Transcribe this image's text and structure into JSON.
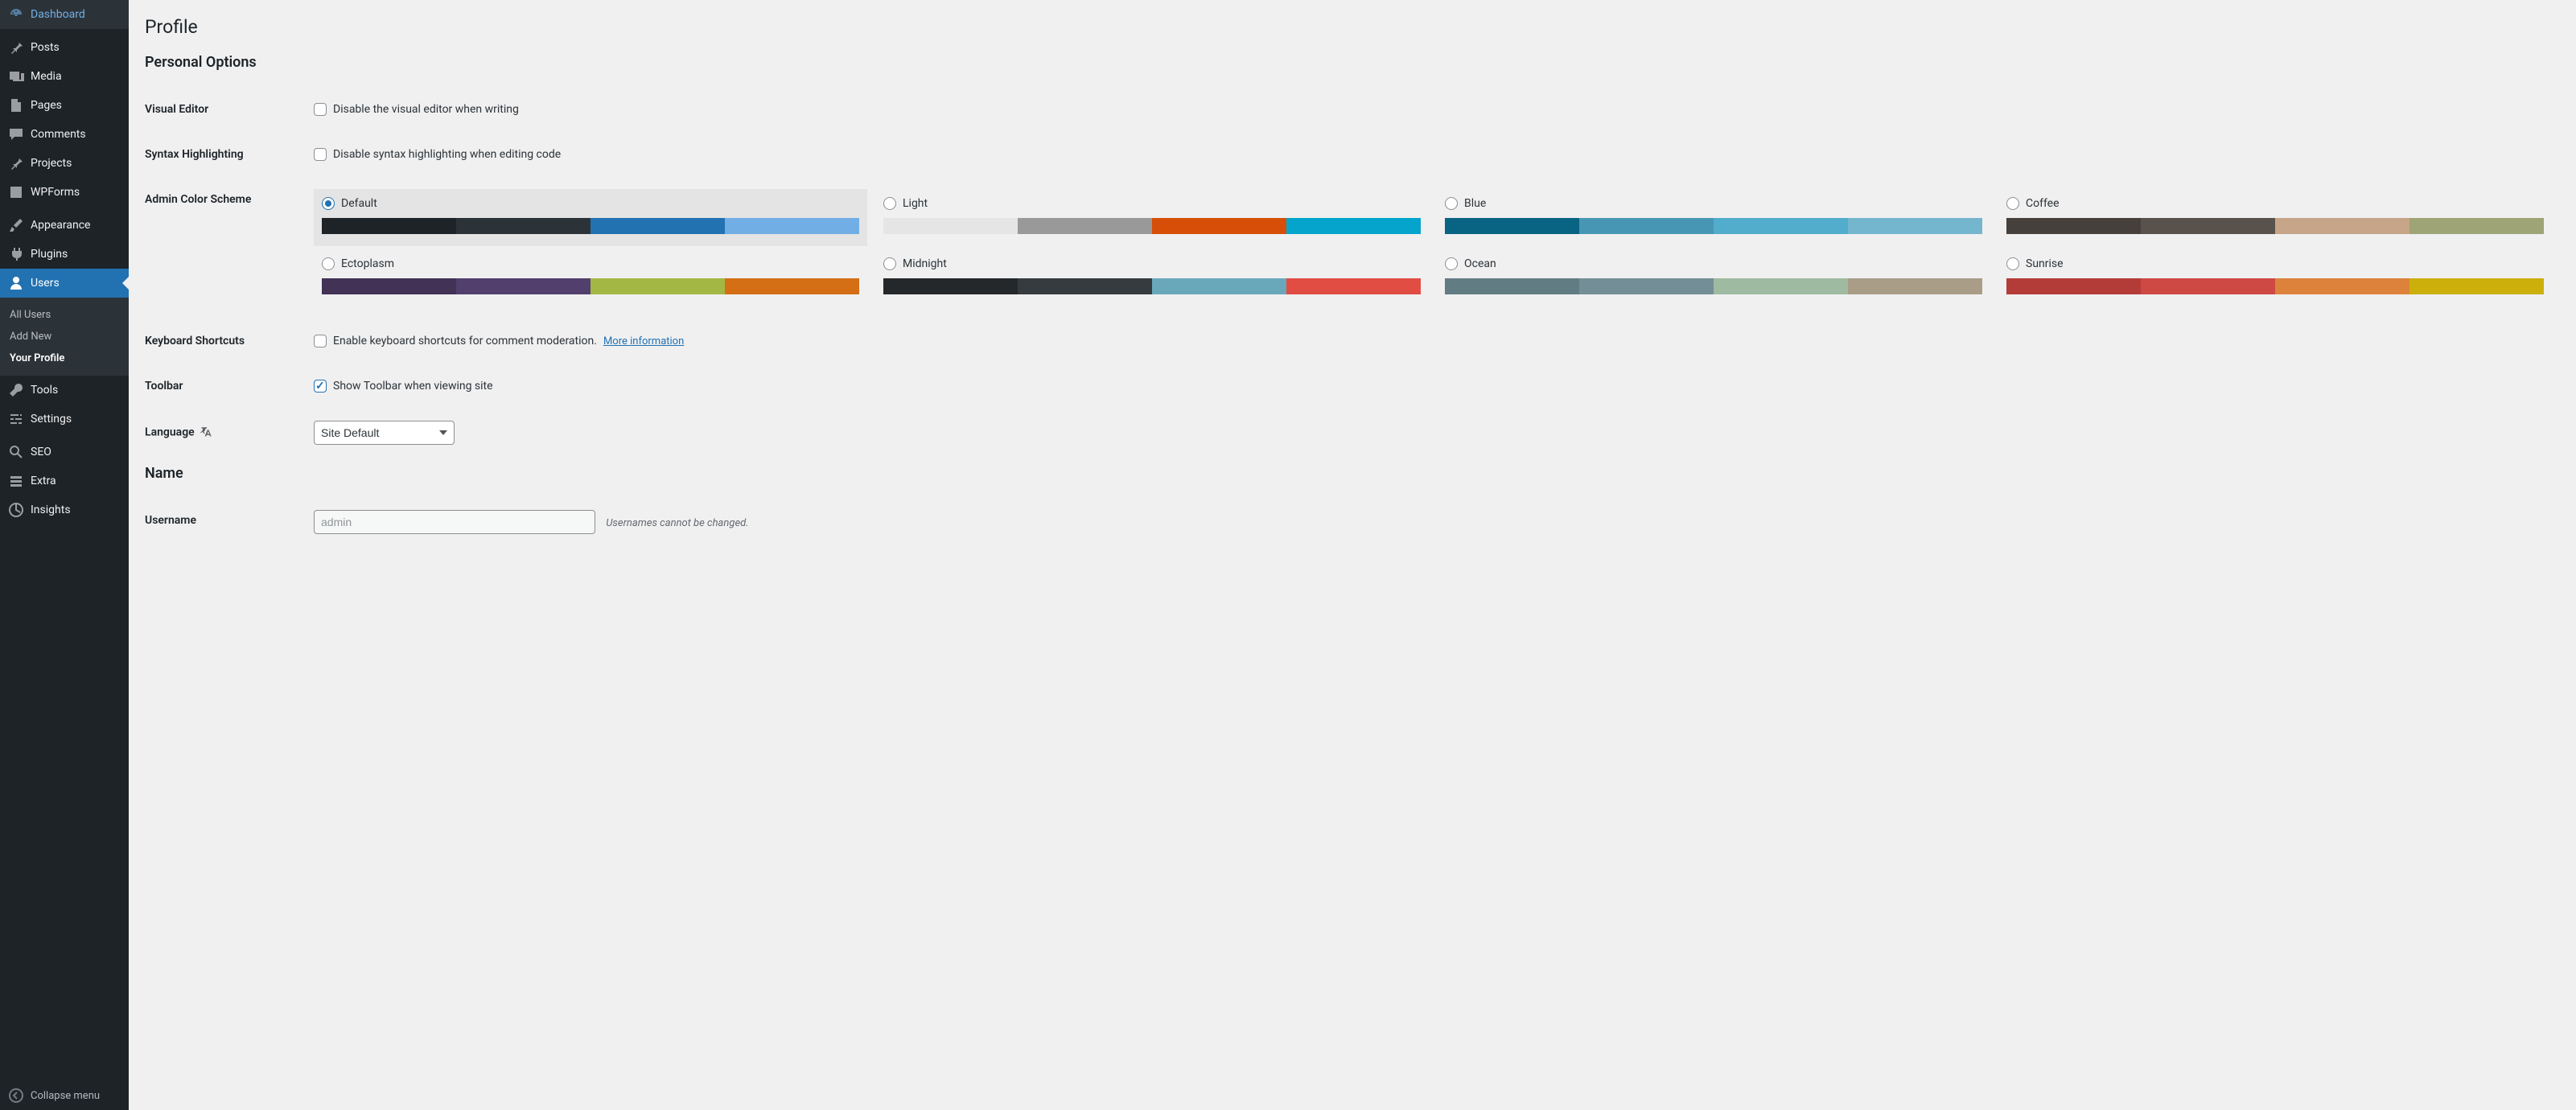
{
  "sidebar": {
    "dashboard": "Dashboard",
    "posts": "Posts",
    "media": "Media",
    "pages": "Pages",
    "comments": "Comments",
    "projects": "Projects",
    "wpforms": "WPForms",
    "appearance": "Appearance",
    "plugins": "Plugins",
    "users": "Users",
    "tools": "Tools",
    "settings": "Settings",
    "seo": "SEO",
    "extra": "Extra",
    "insights": "Insights",
    "collapse": "Collapse menu",
    "submenu": {
      "all_users": "All Users",
      "add_new": "Add New",
      "your_profile": "Your Profile"
    }
  },
  "page": {
    "title": "Profile",
    "section_personal": "Personal Options",
    "section_name": "Name"
  },
  "fields": {
    "visual_editor": {
      "label": "Visual Editor",
      "checkbox": "Disable the visual editor when writing"
    },
    "syntax": {
      "label": "Syntax Highlighting",
      "checkbox": "Disable syntax highlighting when editing code"
    },
    "color_scheme": {
      "label": "Admin Color Scheme"
    },
    "keyboard": {
      "label": "Keyboard Shortcuts",
      "checkbox": "Enable keyboard shortcuts for comment moderation.",
      "more": "More information"
    },
    "toolbar": {
      "label": "Toolbar",
      "checkbox": "Show Toolbar when viewing site"
    },
    "language": {
      "label": "Language",
      "value": "Site Default"
    },
    "username": {
      "label": "Username",
      "value": "admin",
      "description": "Usernames cannot be changed."
    }
  },
  "color_schemes": [
    {
      "name": "Default",
      "selected": true,
      "colors": [
        "#1d2327",
        "#2c3338",
        "#2271b1",
        "#72aee6"
      ]
    },
    {
      "name": "Light",
      "selected": false,
      "colors": [
        "#e5e5e5",
        "#999999",
        "#d64e07",
        "#04a4cc"
      ]
    },
    {
      "name": "Blue",
      "selected": false,
      "colors": [
        "#096484",
        "#4796b3",
        "#52accc",
        "#74b6ce"
      ]
    },
    {
      "name": "Coffee",
      "selected": false,
      "colors": [
        "#46403c",
        "#59524c",
        "#c7a589",
        "#9ea476"
      ]
    },
    {
      "name": "Ectoplasm",
      "selected": false,
      "colors": [
        "#413256",
        "#523f6d",
        "#a3b745",
        "#d46f15"
      ]
    },
    {
      "name": "Midnight",
      "selected": false,
      "colors": [
        "#25282b",
        "#363b3f",
        "#69a8bb",
        "#e14d43"
      ]
    },
    {
      "name": "Ocean",
      "selected": false,
      "colors": [
        "#627c83",
        "#738e96",
        "#9ebaa0",
        "#aa9d88"
      ]
    },
    {
      "name": "Sunrise",
      "selected": false,
      "colors": [
        "#b43c38",
        "#cf4944",
        "#dd823b",
        "#ccaf0b"
      ]
    }
  ]
}
